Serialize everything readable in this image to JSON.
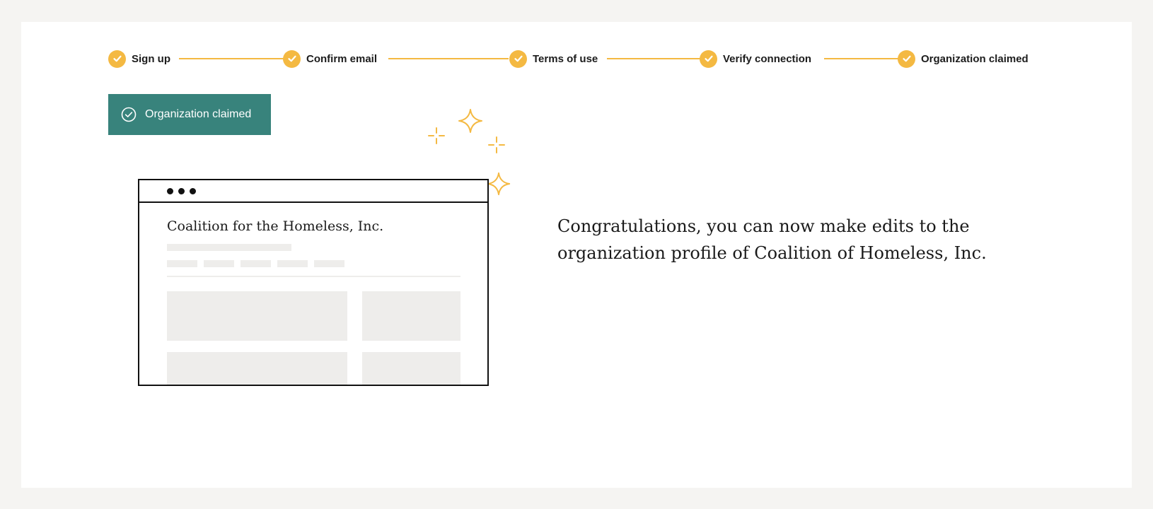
{
  "stepper": {
    "steps": [
      {
        "label": "Sign up",
        "status": "complete"
      },
      {
        "label": "Confirm email",
        "status": "complete"
      },
      {
        "label": "Terms of use",
        "status": "complete"
      },
      {
        "label": "Verify connection",
        "status": "complete"
      },
      {
        "label": "Organization claimed",
        "status": "complete"
      }
    ]
  },
  "badge": {
    "label": "Organization claimed",
    "icon": "check-circle-icon"
  },
  "illustration": {
    "org_name": "Coalition for the Homeless, Inc."
  },
  "message": {
    "text": "Congratulations, you can now make edits to the organization profile of Coalition of Homeless, Inc."
  },
  "colors": {
    "accent": "#f4b942",
    "badge_bg": "#38837c",
    "page_bg": "#f5f4f2",
    "placeholder": "#eeedeb"
  }
}
